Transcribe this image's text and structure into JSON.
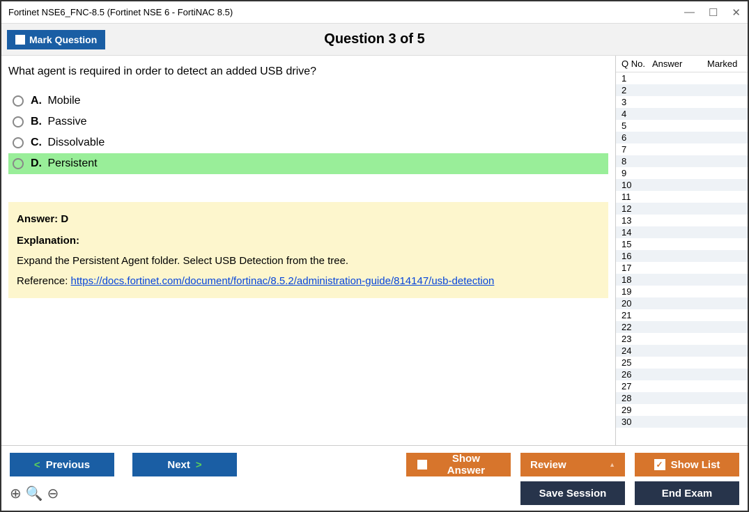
{
  "window": {
    "title": "Fortinet NSE6_FNC-8.5 (Fortinet NSE 6 - FortiNAC 8.5)"
  },
  "header": {
    "mark_label": "Mark Question",
    "question_indicator": "Question 3 of 5"
  },
  "question": {
    "text": "What agent is required in order to detect an added USB drive?",
    "options": [
      {
        "letter": "A.",
        "text": "Mobile",
        "selected": false
      },
      {
        "letter": "B.",
        "text": "Passive",
        "selected": false
      },
      {
        "letter": "C.",
        "text": "Dissolvable",
        "selected": false
      },
      {
        "letter": "D.",
        "text": "Persistent",
        "selected": true
      }
    ]
  },
  "answer": {
    "label": "Answer: D",
    "explanation_label": "Explanation:",
    "explanation_text": "Expand the Persistent Agent folder. Select USB Detection from the tree.",
    "reference_prefix": "Reference: ",
    "reference_url": "https://docs.fortinet.com/document/fortinac/8.5.2/administration-guide/814147/usb-detection"
  },
  "sidebar": {
    "headers": {
      "qno": "Q No.",
      "answer": "Answer",
      "marked": "Marked"
    },
    "rows": [
      1,
      2,
      3,
      4,
      5,
      6,
      7,
      8,
      9,
      10,
      11,
      12,
      13,
      14,
      15,
      16,
      17,
      18,
      19,
      20,
      21,
      22,
      23,
      24,
      25,
      26,
      27,
      28,
      29,
      30
    ]
  },
  "footer": {
    "previous": "Previous",
    "next": "Next",
    "show_answer": "Show Answer",
    "review": "Review",
    "show_list": "Show List",
    "save_session": "Save Session",
    "end_exam": "End Exam"
  }
}
